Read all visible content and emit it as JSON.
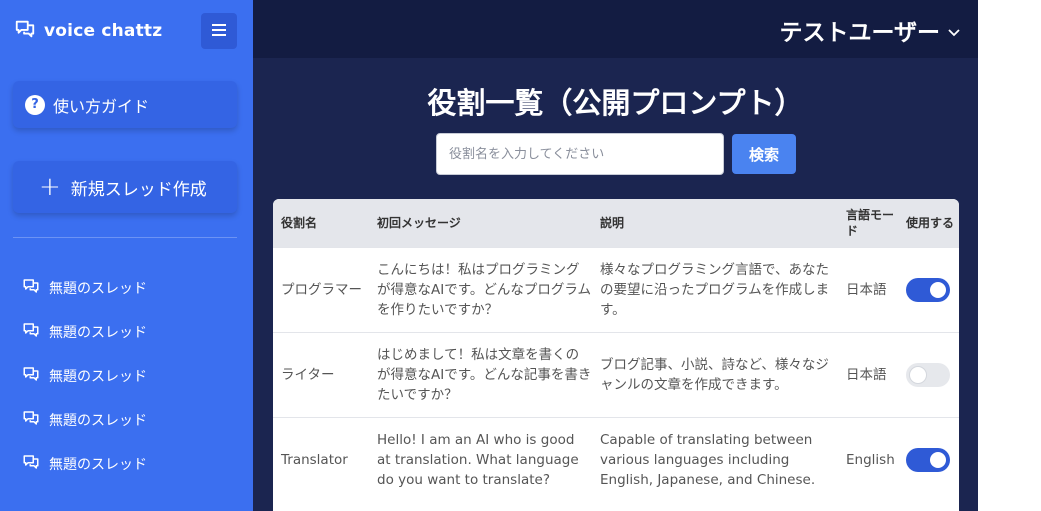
{
  "sidebar": {
    "brand": "voice chattz",
    "guide_label": "使い方ガイド",
    "new_thread_label": "新規スレッド作成",
    "threads": [
      {
        "label": "無題のスレッド"
      },
      {
        "label": "無題のスレッド"
      },
      {
        "label": "無題のスレッド"
      },
      {
        "label": "無題のスレッド"
      },
      {
        "label": "無題のスレッド"
      }
    ]
  },
  "header": {
    "user_name": "テストユーザー"
  },
  "main": {
    "title": "役割一覧（公開プロンプト）",
    "search": {
      "placeholder": "役割名を入力してください",
      "button_label": "検索"
    },
    "table": {
      "columns": {
        "role": "役割名",
        "first_message": "初回メッセージ",
        "description": "説明",
        "language_mode": "言語モード",
        "use": "使用する"
      },
      "rows": [
        {
          "role": "プログラマー",
          "first_message": "こんにちは！私はプログラミングが得意なAIです。どんなプログラムを作りたいですか？",
          "description": "様々なプログラミング言語で、あなたの要望に沿ったプログラムを作成します。",
          "language": "日本語",
          "enabled": true
        },
        {
          "role": "ライター",
          "first_message": "はじめまして！私は文章を書くのが得意なAIです。どんな記事を書きたいですか？",
          "description": "ブログ記事、小説、詩など、様々なジャンルの文章を作成できます。",
          "language": "日本語",
          "enabled": false
        },
        {
          "role": "Translator",
          "first_message": "Hello! I am an AI who is good at translation. What language do you want to translate?",
          "description": "Capable of translating between various languages including English, Japanese, and Chinese.",
          "language": "English",
          "enabled": true
        }
      ]
    }
  },
  "colors": {
    "sidebar_bg": "#3b6ff0",
    "main_bg": "#1b2550",
    "topbar_bg": "#131c42",
    "accent": "#4a83f0",
    "toggle_on": "#2f5ad6"
  }
}
